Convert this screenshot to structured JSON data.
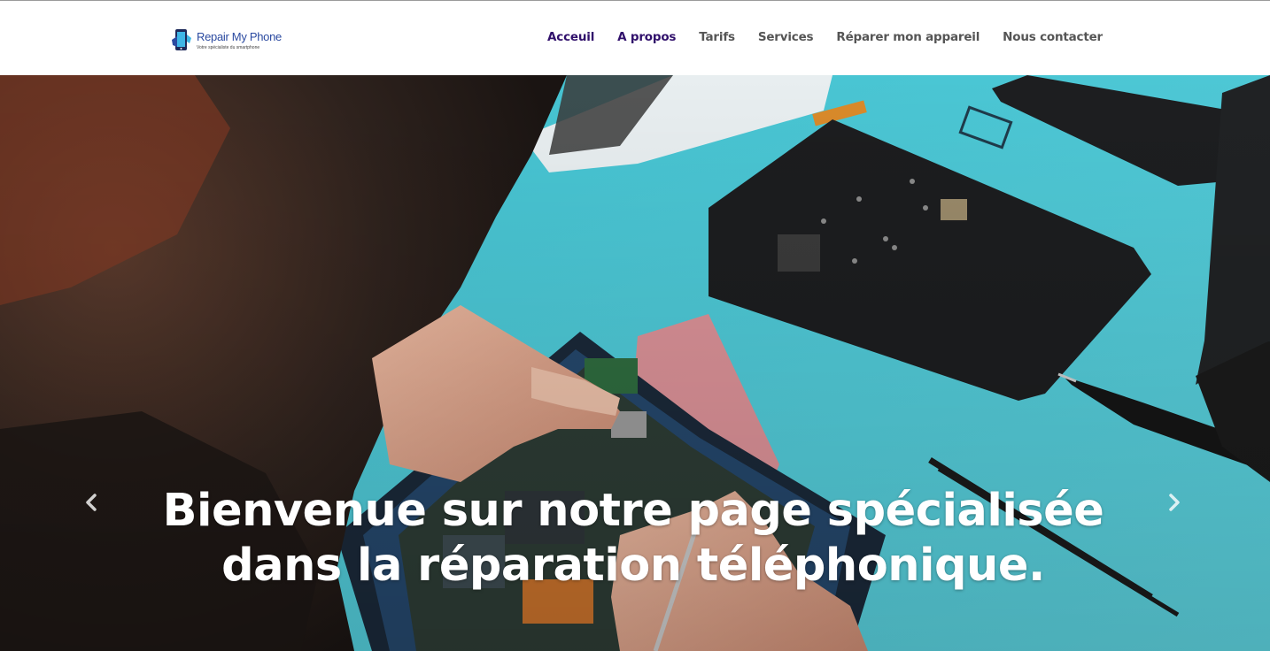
{
  "brand": {
    "name": "Repair My Phone",
    "tagline": "Votre spécialiste du smartphone"
  },
  "nav": {
    "items": [
      {
        "label": "Acceuil",
        "active": true
      },
      {
        "label": "A propos",
        "active": true
      },
      {
        "label": "Tarifs",
        "active": false
      },
      {
        "label": "Services",
        "active": false
      },
      {
        "label": "Réparer mon appareil",
        "active": false
      },
      {
        "label": "Nous contacter",
        "active": false
      }
    ]
  },
  "hero": {
    "title": "Bienvenue sur notre page spécialisée dans la réparation téléphonique.",
    "prev_icon": "chevron-left-icon",
    "next_icon": "chevron-right-icon"
  },
  "colors": {
    "nav_active": "#30106b",
    "nav_default": "#555555",
    "brand_blue": "#2b4aa0",
    "mat_cyan": "#4fc6d4"
  }
}
